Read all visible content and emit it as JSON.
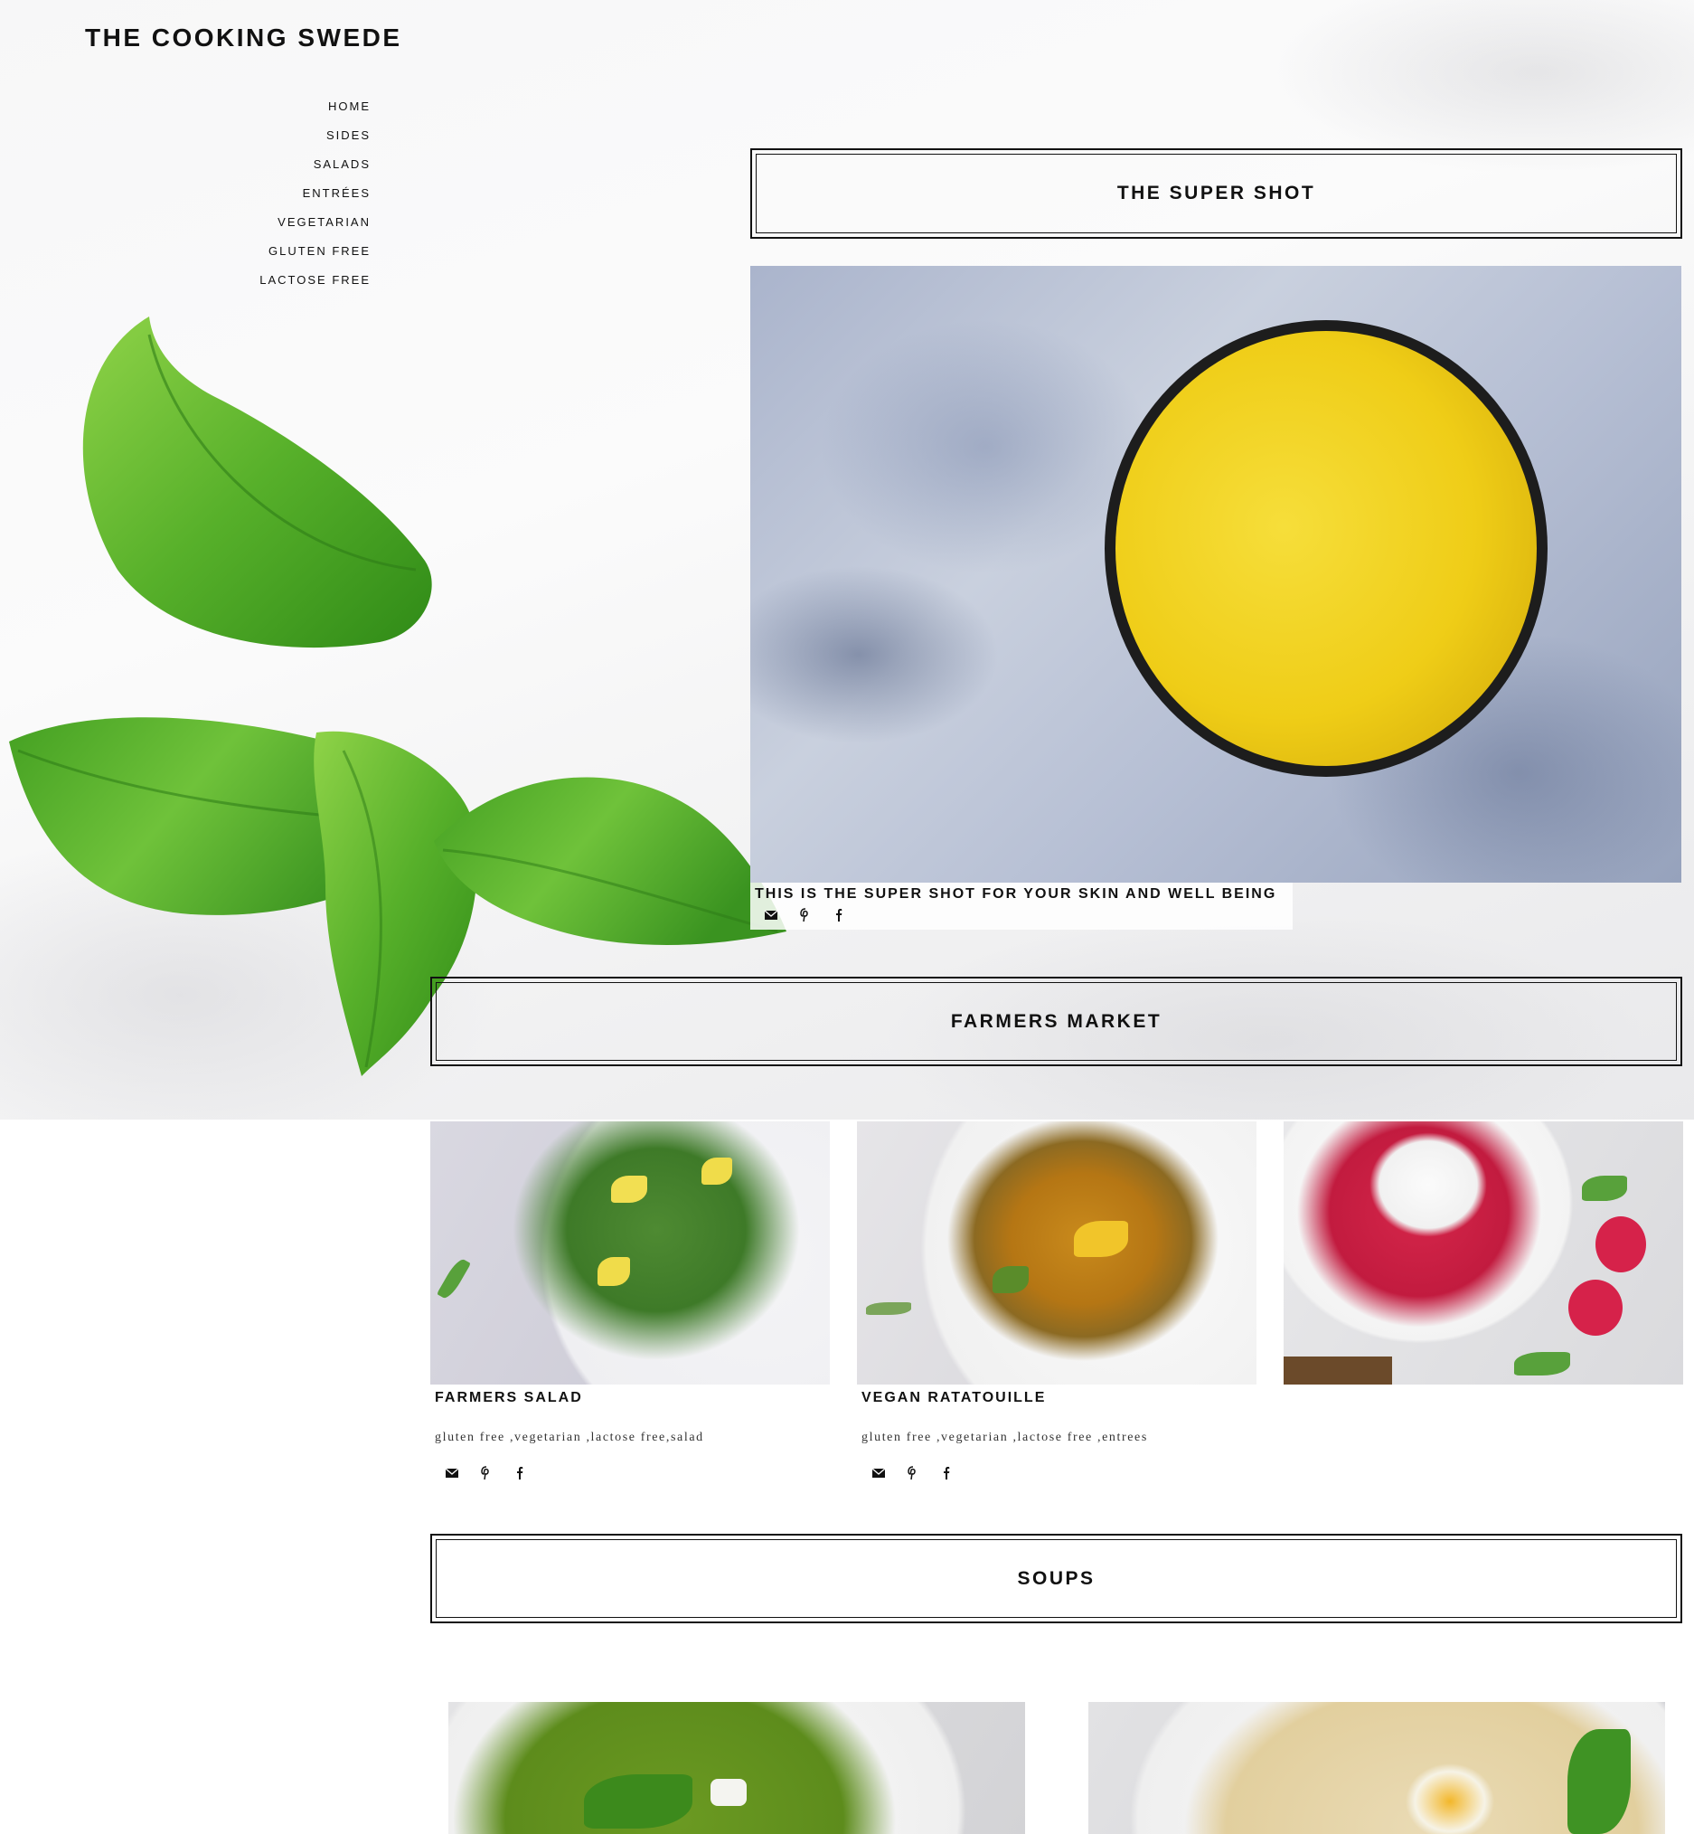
{
  "site": {
    "title": "THE COOKING SWEDE"
  },
  "nav": {
    "items": [
      "HOME",
      "SIDES",
      "SALADS",
      "ENTRÉES",
      "VEGETARIAN",
      "GLUTEN FREE",
      "LACTOSE FREE"
    ]
  },
  "sections": {
    "super_shot": "THE SUPER SHOT",
    "farmers_market": "FARMERS MARKET",
    "soups": "SOUPS"
  },
  "featured": {
    "title": "THIS IS THE SUPER SHOT FOR YOUR SKIN AND WELL BEING",
    "share_icons": [
      "mail-icon",
      "pinterest-icon",
      "facebook-icon"
    ]
  },
  "farmers_market": {
    "cards": [
      {
        "title": "FARMERS SALAD",
        "tags": "gluten free ,vegetarian ,lactose free,salad"
      },
      {
        "title": "VEGAN RATATOUILLE",
        "tags": "gluten free ,vegetarian ,lactose free ,entrees"
      },
      {
        "title": "",
        "tags": ""
      }
    ]
  },
  "colors": {
    "text": "#111111",
    "border": "#111111",
    "basil": "#4fa52a",
    "drink": "#efcd17",
    "marble": "#f4f4f5"
  }
}
